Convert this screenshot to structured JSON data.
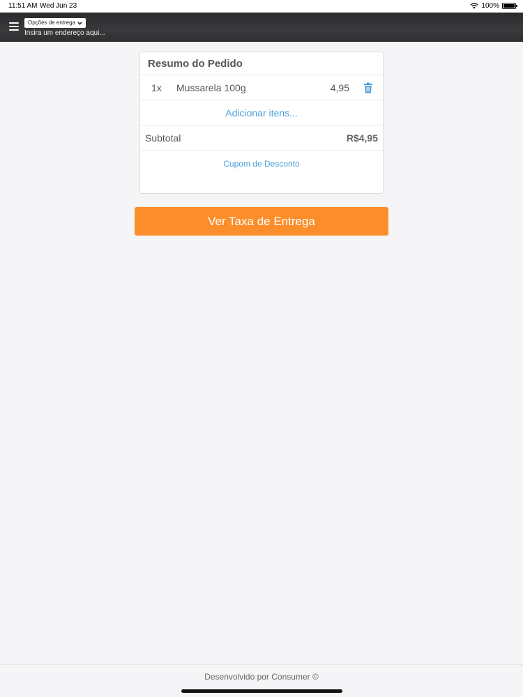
{
  "status_bar": {
    "time": "11:51 AM",
    "date": "Wed Jun 23",
    "battery": "100%"
  },
  "header": {
    "delivery_options": "Opções de entrega",
    "address_placeholder": "Insira um endereço aqui..."
  },
  "order_summary": {
    "title": "Resumo do Pedido",
    "items": [
      {
        "qty": "1x",
        "name": "Mussarela 100g",
        "price": "4,95"
      }
    ],
    "add_items": "Adicionar itens...",
    "subtotal_label": "Subtotal",
    "subtotal_value": "R$4,95",
    "coupon": "Cupom de Desconto"
  },
  "cta_label": "Ver Taxa de Entrega",
  "footer": "Desenvolvido por Consumer ©",
  "colors": {
    "accent": "#fb8e2a",
    "link": "#4a9edb",
    "header_bg": "#333336"
  }
}
